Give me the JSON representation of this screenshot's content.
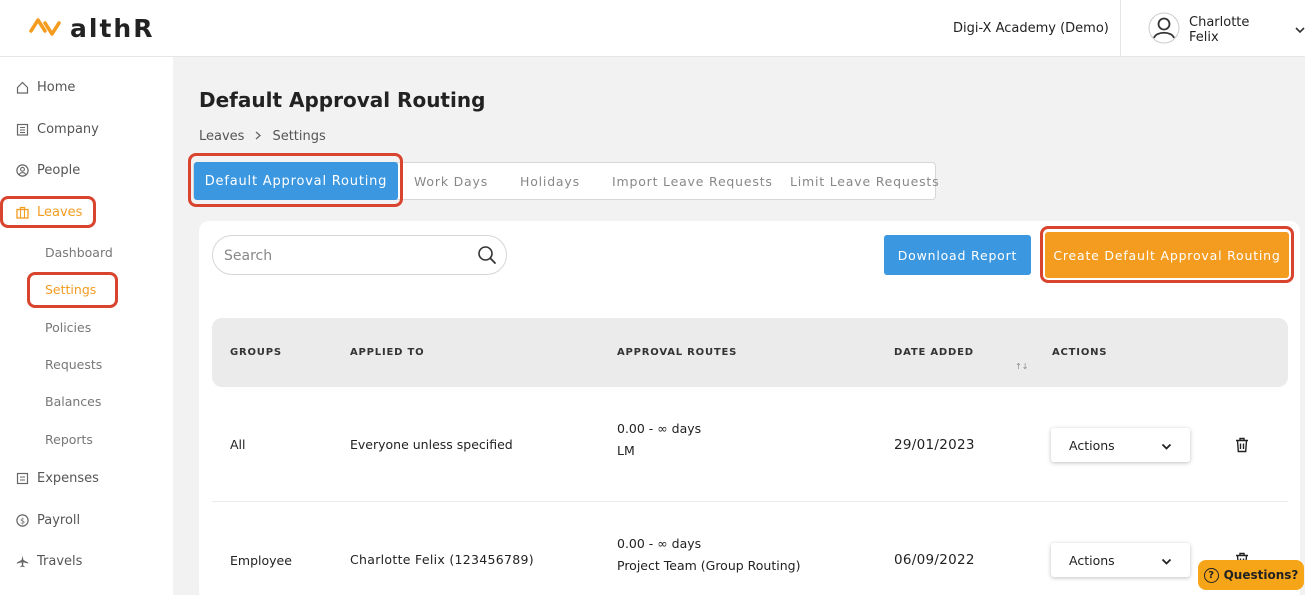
{
  "brand": {
    "name": "althR",
    "accent": "#f39c20",
    "primary": "#3b97e0",
    "highlight": "#d9442f"
  },
  "header": {
    "organization": "Digi-X Academy (Demo)",
    "user_name": "Charlotte Felix"
  },
  "sidebar": {
    "items": [
      {
        "label": "Home",
        "icon": "home-icon"
      },
      {
        "label": "Company",
        "icon": "building-icon"
      },
      {
        "label": "People",
        "icon": "person-icon"
      },
      {
        "label": "Leaves",
        "icon": "briefcase-icon",
        "active": true
      },
      {
        "label": "Expenses",
        "icon": "receipt-icon"
      },
      {
        "label": "Payroll",
        "icon": "dollar-icon"
      },
      {
        "label": "Travels",
        "icon": "plane-icon"
      }
    ],
    "leaves_sub": [
      "Dashboard",
      "Settings",
      "Policies",
      "Requests",
      "Balances",
      "Reports"
    ],
    "active_sub": "Settings"
  },
  "page": {
    "title": "Default Approval Routing",
    "breadcrumb": [
      "Leaves",
      "Settings"
    ]
  },
  "tabs": [
    "Default Approval Routing",
    "Work Days",
    "Holidays",
    "Import Leave Requests",
    "Limit Leave Requests"
  ],
  "toolbar": {
    "search_placeholder": "Search",
    "download_label": "Download Report",
    "create_label": "Create Default Approval Routing"
  },
  "table": {
    "columns": [
      "GROUPS",
      "APPLIED TO",
      "APPROVAL ROUTES",
      "DATE ADDED",
      "ACTIONS"
    ],
    "sort_glyph": "↑↓",
    "rows": [
      {
        "group": "All",
        "applied_to": "Everyone unless specified",
        "route_range": "0.00 - ∞ days",
        "route_name": "LM",
        "date_added": "29/01/2023",
        "action_label": "Actions"
      },
      {
        "group": "Employee",
        "applied_to": "Charlotte Felix (123456789)",
        "route_range": "0.00 - ∞ days",
        "route_name": "Project Team (Group Routing)",
        "date_added": "06/09/2022",
        "action_label": "Actions"
      }
    ]
  },
  "help": {
    "label": "Questions?",
    "icon": "question-icon"
  }
}
